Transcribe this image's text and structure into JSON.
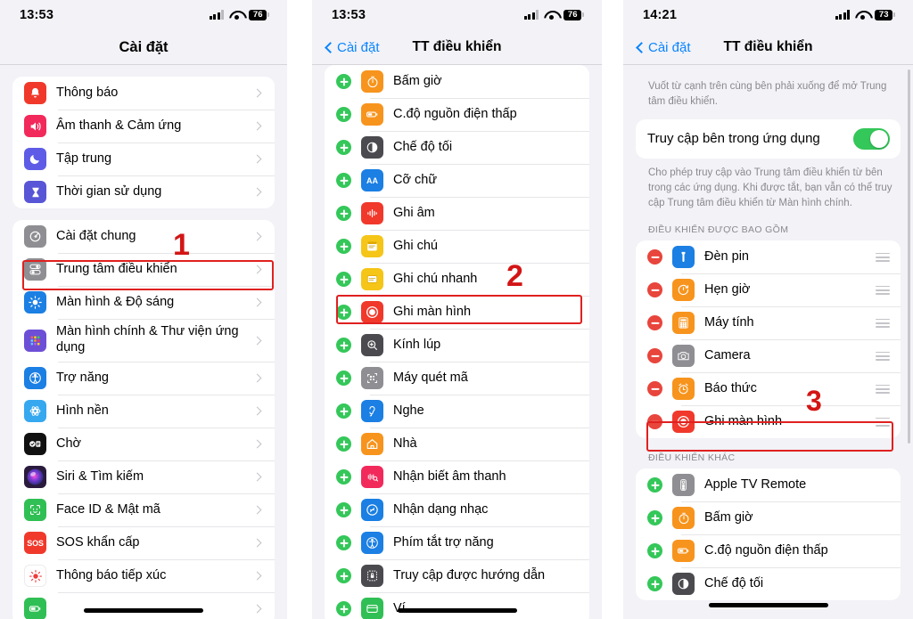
{
  "panels": [
    {
      "id": "settings-root",
      "status": {
        "time": "13:53",
        "battery": "76",
        "signal_bars": 3,
        "wifi": true
      },
      "nav": {
        "title": "Cài đặt",
        "back_label": null
      },
      "groups": [
        {
          "rows": [
            {
              "label": "Thông báo",
              "icon": "notifications-icon",
              "color": "#f0392b"
            },
            {
              "label": "Âm thanh & Cảm ứng",
              "icon": "sound-haptics-icon",
              "color": "#f2295b"
            },
            {
              "label": "Tập trung",
              "icon": "focus-icon",
              "color": "#5e5ce6"
            },
            {
              "label": "Thời gian sử dụng",
              "icon": "screen-time-icon",
              "color": "#5856d6"
            }
          ]
        },
        {
          "rows": [
            {
              "label": "Cài đặt chung",
              "icon": "general-gear-icon",
              "color": "#8e8e93"
            },
            {
              "label": "Trung tâm điều khiển",
              "icon": "control-center-icon",
              "color": "#8e8e93",
              "highlight": true
            },
            {
              "label": "Màn hình & Độ sáng",
              "icon": "display-brightness-icon",
              "color": "#1b7fe3"
            },
            {
              "label": "Màn hình chính & Thư viện ứng dụng",
              "icon": "home-screen-icon",
              "color": "#6c4fd6",
              "tall": true
            },
            {
              "label": "Trợ năng",
              "icon": "accessibility-icon",
              "color": "#1b7fe3"
            },
            {
              "label": "Hình nền",
              "icon": "wallpaper-icon",
              "color": "#36a8ef"
            },
            {
              "label": "Chờ",
              "icon": "standby-icon",
              "color": "#111111"
            },
            {
              "label": "Siri & Tìm kiếm",
              "icon": "siri-icon",
              "color": "#2a1b3d"
            },
            {
              "label": "Face ID & Mật mã",
              "icon": "face-id-icon",
              "color": "#30bf54"
            },
            {
              "label": "SOS khẩn cấp",
              "icon": "sos-icon",
              "color": "#f0392b"
            },
            {
              "label": "Thông báo tiếp xúc",
              "icon": "exposure-notification-icon",
              "color": "#ffffff"
            },
            {
              "label": "",
              "icon": "battery-icon",
              "color": "#30bf54"
            }
          ]
        }
      ]
    },
    {
      "id": "control-center-more",
      "status": {
        "time": "13:53",
        "battery": "76",
        "signal_bars": 3,
        "wifi": true
      },
      "nav": {
        "title": "TT điều khiển",
        "back_label": "Cài đặt"
      },
      "groups": [
        {
          "rows": [
            {
              "label": "Bấm giờ",
              "icon": "stopwatch-icon",
              "color": "#f7941d",
              "ctl": "plus"
            },
            {
              "label": "C.độ nguồn điện thấp",
              "icon": "low-power-icon",
              "color": "#f7941d",
              "ctl": "plus"
            },
            {
              "label": "Chế độ tối",
              "icon": "dark-mode-icon",
              "color": "#4a4a4f",
              "ctl": "plus"
            },
            {
              "label": "Cỡ chữ",
              "icon": "text-size-icon",
              "color": "#1b7fe3",
              "ctl": "plus"
            },
            {
              "label": "Ghi âm",
              "icon": "voice-memo-icon",
              "color": "#f0392b",
              "ctl": "plus"
            },
            {
              "label": "Ghi chú",
              "icon": "notes-icon",
              "color": "#f5c518",
              "ctl": "plus"
            },
            {
              "label": "Ghi chú nhanh",
              "icon": "quick-note-icon",
              "color": "#f5c518",
              "ctl": "plus"
            },
            {
              "label": "Ghi màn hình",
              "icon": "screen-record-icon",
              "color": "#f0392b",
              "ctl": "plus",
              "highlight": true
            },
            {
              "label": "Kính lúp",
              "icon": "magnifier-icon",
              "color": "#4a4a4f",
              "ctl": "plus"
            },
            {
              "label": "Máy quét mã",
              "icon": "code-scanner-icon",
              "color": "#8e8e93",
              "ctl": "plus"
            },
            {
              "label": "Nghe",
              "icon": "hearing-icon",
              "color": "#1b7fe3",
              "ctl": "plus"
            },
            {
              "label": "Nhà",
              "icon": "home-app-icon",
              "color": "#f7941d",
              "ctl": "plus"
            },
            {
              "label": "Nhận biết âm thanh",
              "icon": "sound-recognition-icon",
              "color": "#f2295b",
              "ctl": "plus"
            },
            {
              "label": "Nhận dạng nhạc",
              "icon": "shazam-icon",
              "color": "#1b7fe3",
              "ctl": "plus"
            },
            {
              "label": "Phím tắt trợ năng",
              "icon": "accessibility-shortcut-icon",
              "color": "#1b7fe3",
              "ctl": "plus"
            },
            {
              "label": "Truy cập được hướng dẫn",
              "icon": "guided-access-icon",
              "color": "#4a4a4f",
              "ctl": "plus"
            },
            {
              "label": "Ví",
              "icon": "wallet-icon",
              "color": "#30bf54",
              "ctl": "plus"
            }
          ]
        }
      ]
    },
    {
      "id": "control-center-config",
      "status": {
        "time": "14:21",
        "battery": "73",
        "signal_bars": 4,
        "wifi": true
      },
      "nav": {
        "title": "TT điều khiển",
        "back_label": "Cài đặt"
      },
      "blurb_top": "Vuốt từ cạnh trên cùng bên phải xuống để mở Trung tâm điều khiển.",
      "toggle_row": {
        "label": "Truy cập bên trong ứng dụng",
        "on": true
      },
      "blurb_bottom": "Cho phép truy cập vào Trung tâm điều khiển từ bên trong các ứng dụng. Khi được tắt, bạn vẫn có thể truy cập Trung tâm điều khiển từ Màn hình chính.",
      "sections": [
        {
          "header": "ĐIỀU KHIỂN ĐƯỢC BAO GỒM",
          "rows": [
            {
              "label": "Đèn pin",
              "icon": "flashlight-icon",
              "color": "#1b7fe3",
              "ctl": "minus",
              "reorder": true
            },
            {
              "label": "Hẹn giờ",
              "icon": "timer-icon",
              "color": "#f7941d",
              "ctl": "minus",
              "reorder": true
            },
            {
              "label": "Máy tính",
              "icon": "calculator-icon",
              "color": "#f7941d",
              "ctl": "minus",
              "reorder": true
            },
            {
              "label": "Camera",
              "icon": "camera-icon",
              "color": "#8e8e93",
              "ctl": "minus",
              "reorder": true
            },
            {
              "label": "Báo thức",
              "icon": "alarm-icon",
              "color": "#f7941d",
              "ctl": "minus",
              "reorder": true
            },
            {
              "label": "Ghi màn hình",
              "icon": "screen-record-icon",
              "color": "#f0392b",
              "ctl": "minus",
              "reorder": true,
              "highlight": true
            }
          ]
        },
        {
          "header": "ĐIỀU KHIỂN KHÁC",
          "rows": [
            {
              "label": "Apple TV Remote",
              "icon": "apple-tv-remote-icon",
              "color": "#8e8e93",
              "ctl": "plus"
            },
            {
              "label": "Bấm giờ",
              "icon": "stopwatch-icon",
              "color": "#f7941d",
              "ctl": "plus"
            },
            {
              "label": "C.độ nguồn điện thấp",
              "icon": "low-power-icon",
              "color": "#f7941d",
              "ctl": "plus"
            },
            {
              "label": "Chế độ tối",
              "icon": "dark-mode-icon",
              "color": "#4a4a4f",
              "ctl": "plus"
            }
          ]
        }
      ]
    }
  ],
  "annotations": [
    {
      "number": "1",
      "panel": 1
    },
    {
      "number": "2",
      "panel": 2
    },
    {
      "number": "3",
      "panel": 3
    }
  ],
  "colors": {
    "accent_blue": "#0a84ff",
    "green": "#34c759",
    "red": "#e8453c",
    "annotation_red": "#d31515"
  }
}
